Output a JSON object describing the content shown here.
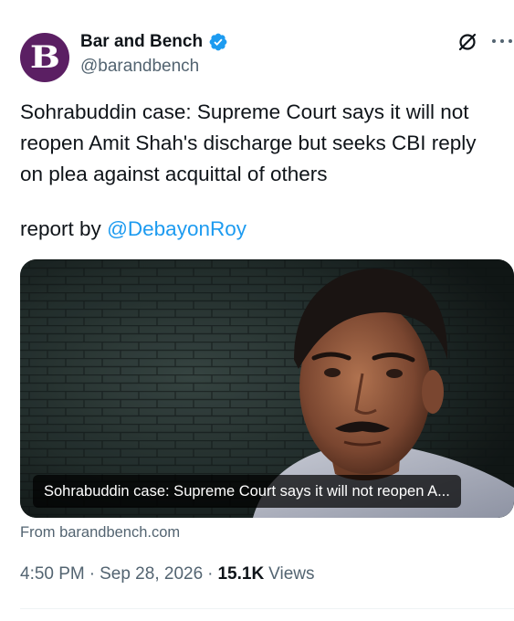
{
  "author": {
    "avatar_letter": "B",
    "name": "Bar and Bench",
    "handle": "@barandbench"
  },
  "tweet": {
    "text": "Sohrabuddin case: Supreme Court says it will not reopen Amit Shah's discharge but seeks CBI reply on plea against acquittal of others",
    "report_prefix": "report by",
    "mention": "@DebayonRoy"
  },
  "card": {
    "caption": "Sohrabuddin case: Supreme Court says it will not reopen A...",
    "source": "From barandbench.com"
  },
  "meta": {
    "time": "4:50 PM",
    "separator": "·",
    "date": "Sep 28, 2026",
    "separator2": "·",
    "views_count": "15.1K",
    "views_label": "Views"
  },
  "colors": {
    "avatar_bg": "#5b1f63",
    "link": "#1d9bf0",
    "verified": "#1d9bf0",
    "secondary_text": "#536471"
  },
  "icons": [
    "verified-badge-icon",
    "grok-icon",
    "more-options-icon"
  ]
}
